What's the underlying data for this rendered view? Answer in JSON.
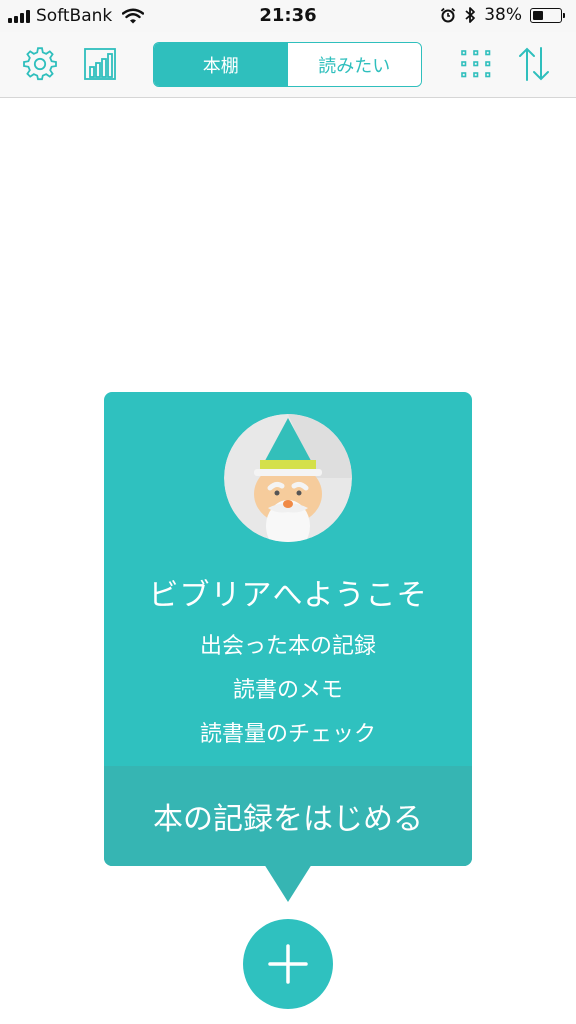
{
  "status_bar": {
    "carrier": "SoftBank",
    "time": "21:36",
    "battery_percent": "38%",
    "battery_level": 0.38,
    "icons": [
      "signal-icon",
      "wifi-icon",
      "alarm-icon",
      "bluetooth-icon",
      "battery-icon"
    ]
  },
  "nav": {
    "left_icons": [
      "gear-icon",
      "bar-chart-icon"
    ],
    "tabs": [
      {
        "label": "本棚",
        "active": true
      },
      {
        "label": "読みたい",
        "active": false
      }
    ],
    "right_icons": [
      "grid-icon",
      "sort-icon"
    ]
  },
  "welcome": {
    "title": "ビブリアへようこそ",
    "features": [
      "出会った本の記録",
      "読書のメモ",
      "読書量のチェック"
    ],
    "action_label": "本の記録をはじめる",
    "mascot_icon": "wizard-avatar-icon"
  },
  "fab": {
    "icon": "plus-icon"
  },
  "colors": {
    "accent": "#2fc1bf",
    "accent_dark": "#36b5b3",
    "nav_background": "#f8f8f8",
    "background": "#ffffff"
  }
}
